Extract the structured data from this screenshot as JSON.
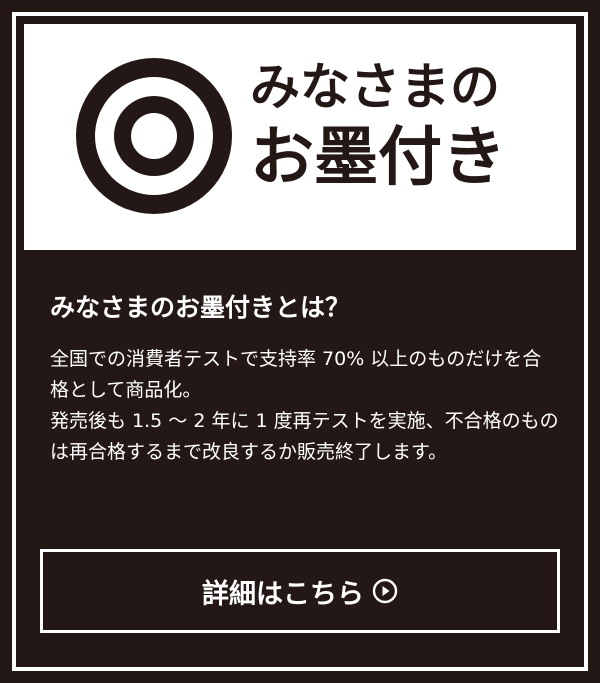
{
  "brand": {
    "logo_line1": "みなさまの",
    "logo_line2": "お墨付き",
    "ink_color": "#231815",
    "paper_color": "#ffffff"
  },
  "about": {
    "title": "みなさまのお墨付きとは？",
    "paragraph1": "全国での消費者テストで支持率 70% 以上のものだけを合格として商品化。",
    "paragraph2": "発売後も 1.5 〜 2 年に 1 度再テストを実施、不合格のものは再合格するまで改良するか販売終了します。"
  },
  "cta": {
    "label": "詳細はこちら",
    "icon": "play-circle-icon"
  }
}
